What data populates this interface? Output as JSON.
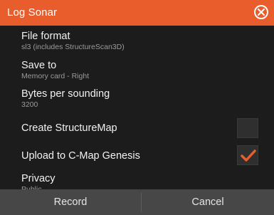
{
  "dialog": {
    "title": "Log Sonar",
    "close_icon": "close-circle-x-icon"
  },
  "settings": {
    "file_format": {
      "label": "File format",
      "value": "sl3 (includes StructureScan3D)"
    },
    "save_to": {
      "label": "Save to",
      "value": "Memory card - Right"
    },
    "bytes_per_sounding": {
      "label": "Bytes per sounding",
      "value": "3200"
    },
    "create_structuremap": {
      "label": "Create StructureMap",
      "checked": false
    },
    "upload_cmap": {
      "label": "Upload to C-Map Genesis",
      "checked": true,
      "check_icon": "checkmark-icon"
    },
    "privacy": {
      "label": "Privacy",
      "value": "Public"
    }
  },
  "footer": {
    "record_label": "Record",
    "cancel_label": "Cancel"
  },
  "colors": {
    "accent": "#e95c2c",
    "background": "#1c1c1c",
    "footer": "#474747",
    "checkmark": "#e95c2c"
  }
}
